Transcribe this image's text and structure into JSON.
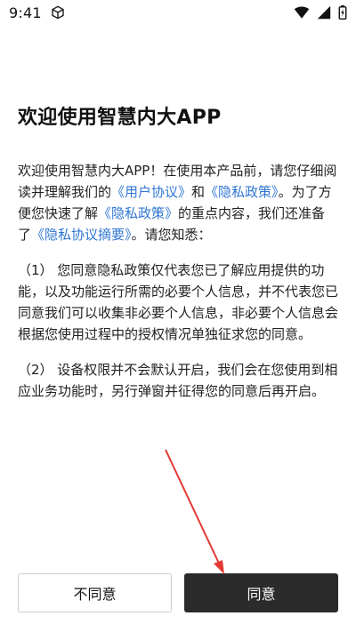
{
  "status_bar": {
    "time": "9:41",
    "left_icon": "cube-icon",
    "right_icons": [
      "wifi-icon",
      "signal-icon",
      "battery-icon"
    ]
  },
  "title": "欢迎使用智慧内大APP",
  "paragraphs": {
    "p1": {
      "part1": "欢迎使用智慧内大APP！在使用本产品前，请您仔细阅读并理解我们的",
      "link1": "《用户协议》",
      "and": "和",
      "link2": "《隐私政策》",
      "part2": "。为了方便您快速了解",
      "link3": "《隐私政策》",
      "part3": "的重点内容，我们还准备了",
      "link4": "《隐私协议摘要》",
      "part4": "。请您知悉："
    },
    "p2": "（1）  您同意隐私政策仅代表您已了解应用提供的功能，以及功能运行所需的必要个人信息，并不代表您已同意我们可以收集非必要个人信息，非必要个人信息会根据您使用过程中的授权情况单独征求您的同意。",
    "p3": "（2）  设备权限并不会默认开启，我们会在您使用到相应业务功能时，另行弹窗并征得您的同意后再开启。"
  },
  "buttons": {
    "disagree": "不同意",
    "agree": "同意"
  },
  "colors": {
    "link": "#2f76d2",
    "primary_button": "#2b2b2b",
    "annotation_arrow": "#e53935"
  }
}
